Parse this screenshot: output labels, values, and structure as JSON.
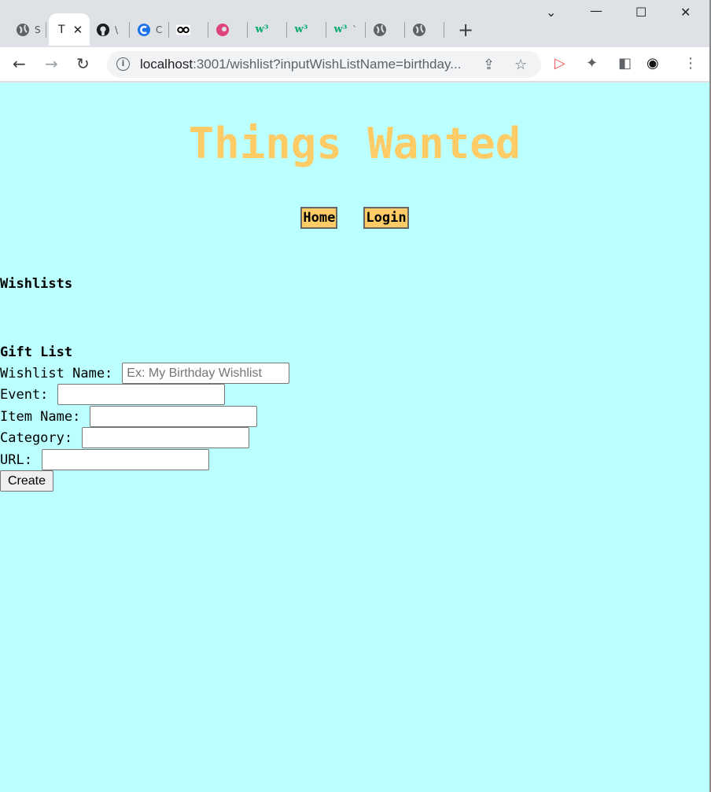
{
  "browser": {
    "tabs": [
      {
        "icon": "globe-icon",
        "title": "S"
      },
      {
        "icon": "page-icon",
        "title": "T",
        "active": true
      },
      {
        "icon": "github-icon",
        "title": "\\"
      },
      {
        "icon": "c-icon",
        "title": "C"
      },
      {
        "icon": "glasses-icon",
        "title": ""
      },
      {
        "icon": "canva-icon",
        "title": ""
      },
      {
        "icon": "w3-icon",
        "title": ""
      },
      {
        "icon": "w3-icon",
        "title": ""
      },
      {
        "icon": "w3-icon",
        "title": "`"
      },
      {
        "icon": "globe-icon",
        "title": ""
      },
      {
        "icon": "globe-icon",
        "title": ""
      }
    ],
    "url_host": "localhost",
    "url_rest": ":3001/wishlist?inputWishListName=birthday..."
  },
  "page": {
    "title": "Things Wanted",
    "nav": {
      "home": "Home",
      "login": "Login"
    },
    "wishlists_heading": "Wishlists",
    "gift_heading": "Gift List",
    "form": {
      "wishlist_name_label": "Wishlist Name:",
      "wishlist_name_placeholder": "Ex: My Birthday Wishlist",
      "event_label": "Event:",
      "item_name_label": "Item Name:",
      "category_label": "Category:",
      "url_label": "URL:",
      "create_label": "Create"
    }
  },
  "colors": {
    "background": "#bcffff",
    "accent": "#fdcc66"
  }
}
